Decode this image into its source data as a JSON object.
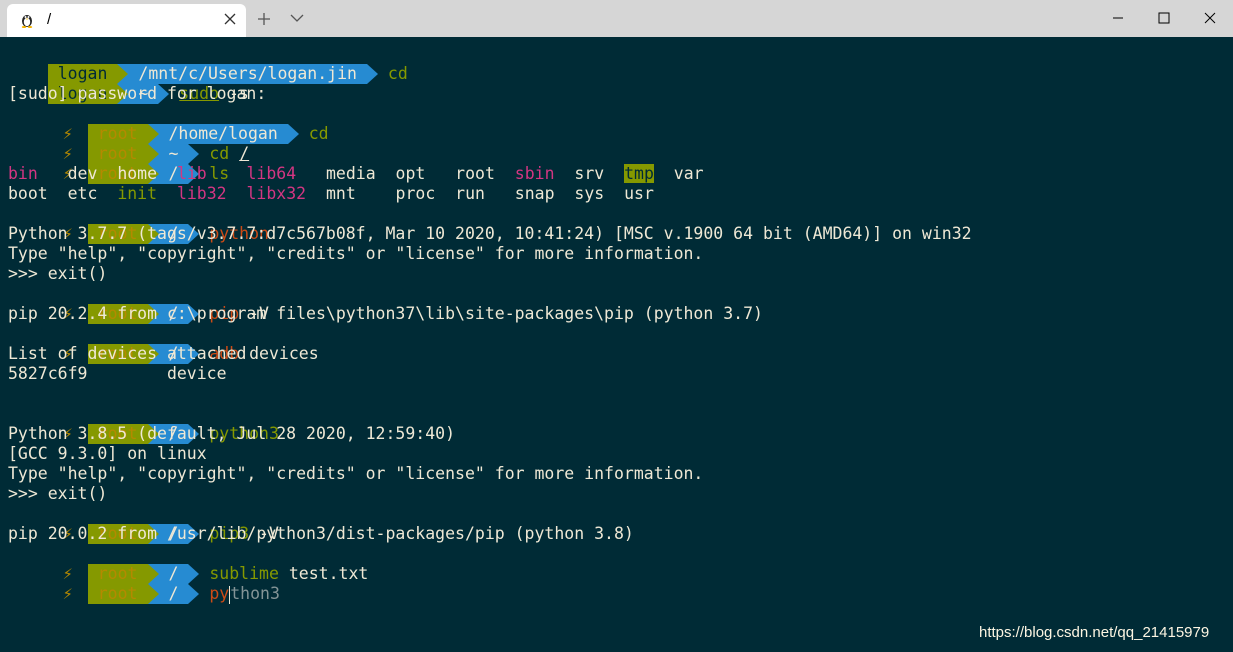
{
  "titlebar": {
    "tab_title": "/",
    "tab_icon": "linux-penguin-icon",
    "close_tab_icon": "close-icon",
    "new_tab_icon": "plus-icon",
    "dropdown_icon": "chevron-down-icon",
    "window_controls": [
      "minimize-icon",
      "maximize-icon",
      "close-icon"
    ]
  },
  "colors": {
    "background": "#002b36",
    "prompt_user_bg": "#859900",
    "prompt_path_bg": "#268bd2",
    "command": "#cb4b16",
    "command_alt": "#859900",
    "highlight": "#d33682"
  },
  "prompts": {
    "user": "logan",
    "root": "root",
    "bolt": "⚡",
    "path_mnt": "/mnt/c/Users/logan.jin",
    "path_home": "~",
    "path_root_home": "/home/logan",
    "path_root": "/"
  },
  "lines": {
    "l1_cmd": "cd",
    "l2_cmd": "sudo",
    "l2_arg": " -s",
    "l3": "[sudo] password for logan:",
    "l4_cmd": "cd",
    "l5_cmd": "cd",
    "l5_arg": "/",
    "l6_cmd": "ls",
    "ls_row1": [
      {
        "t": "bin",
        "c": "pink"
      },
      {
        "t": "dev"
      },
      {
        "t": "home"
      },
      {
        "t": "lib",
        "c": "pink"
      },
      {
        "t": "lib64",
        "c": "pink"
      },
      {
        "t": "media"
      },
      {
        "t": "opt"
      },
      {
        "t": "root"
      },
      {
        "t": "sbin",
        "c": "pink"
      },
      {
        "t": "srv"
      },
      {
        "t": "tmp",
        "c": "tmp"
      },
      {
        "t": "var"
      }
    ],
    "ls_row2": [
      {
        "t": "boot"
      },
      {
        "t": "etc"
      },
      {
        "t": "init",
        "c": "yellowgreen"
      },
      {
        "t": "lib32",
        "c": "pink"
      },
      {
        "t": "libx32",
        "c": "pink"
      },
      {
        "t": "mnt"
      },
      {
        "t": "proc"
      },
      {
        "t": "run"
      },
      {
        "t": "snap"
      },
      {
        "t": "sys"
      },
      {
        "t": "usr"
      }
    ],
    "l9_cmd": "python",
    "l10": "Python 3.7.7 (tags/v3.7.7:d7c567b08f, Mar 10 2020, 10:41:24) [MSC v.1900 64 bit (AMD64)] on win32",
    "l11": "Type \"help\", \"copyright\", \"credits\" or \"license\" for more information.",
    "l12": ">>> exit()",
    "l13_cmd": "pip",
    "l13_arg": " -V",
    "l14": "pip 20.2.4 from c:\\program files\\python37\\lib\\site-packages\\pip (python 3.7)",
    "l15_cmd": "adb",
    "l15_arg": " devices",
    "l16": "List of devices attached",
    "l17": "5827c6f9        device",
    "l19_cmd": "python3",
    "l20": "Python 3.8.5 (default, Jul 28 2020, 12:59:40)",
    "l21": "[GCC 9.3.0] on linux",
    "l22": "Type \"help\", \"copyright\", \"credits\" or \"license\" for more information.",
    "l23": ">>> exit()",
    "l24_cmd": "pip3",
    "l24_arg": " -V",
    "l25": "pip 20.0.2 from /usr/lib/python3/dist-packages/pip (python 3.8)",
    "l26_cmd": "sublime",
    "l26_arg": " test.txt",
    "l27_typed": "py",
    "l27_ghost": "thon3"
  },
  "watermark": "https://blog.csdn.net/qq_21415979"
}
